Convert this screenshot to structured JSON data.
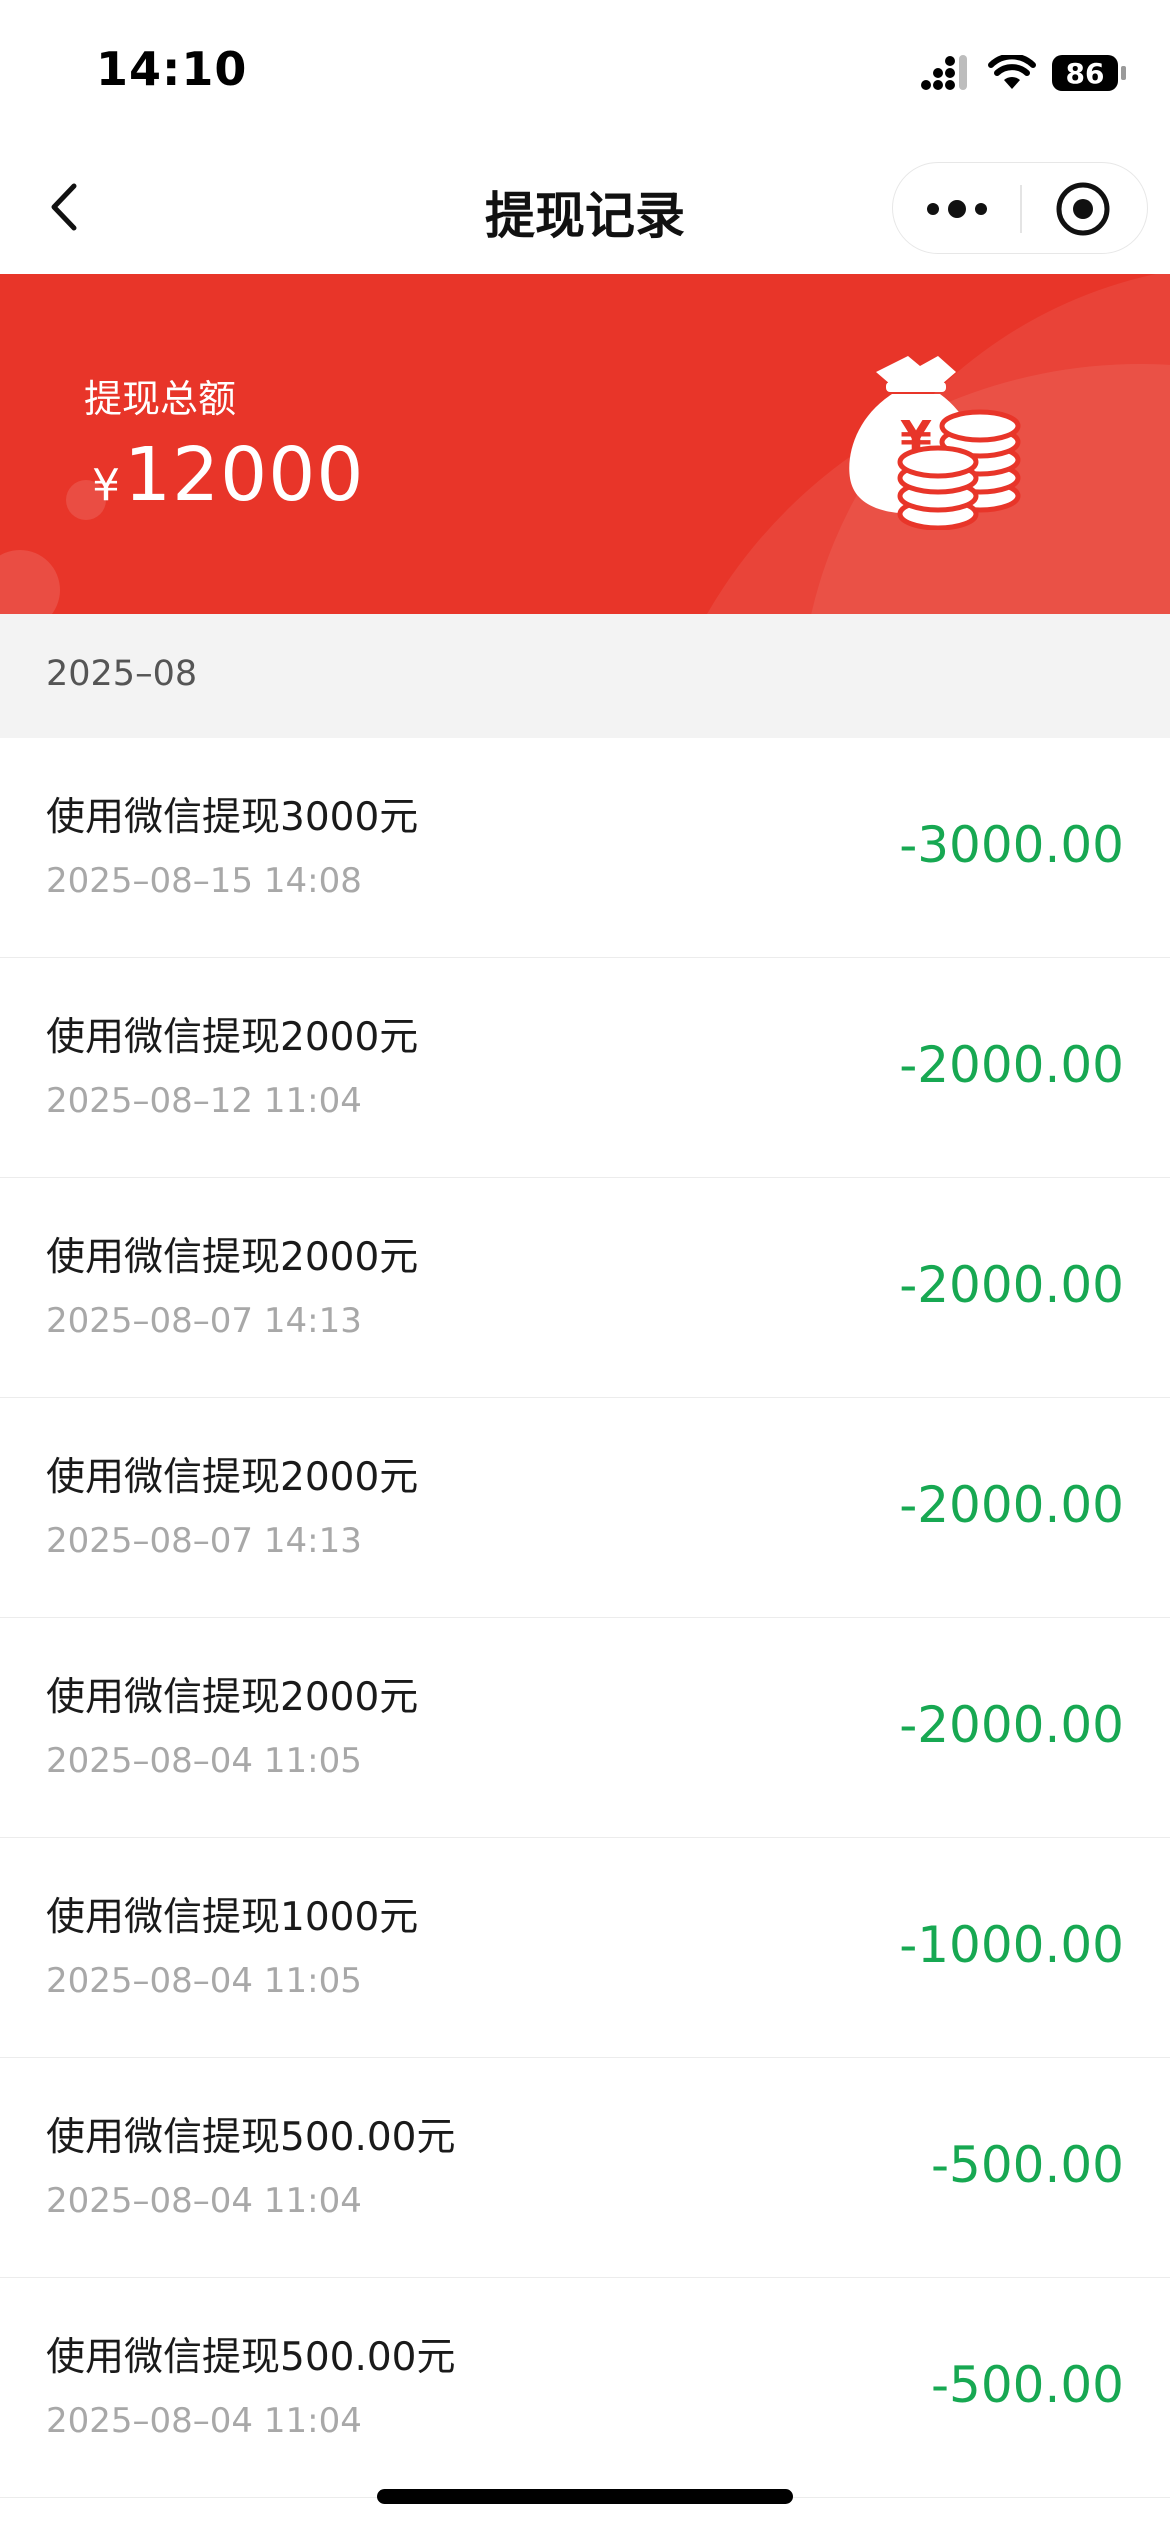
{
  "status_bar": {
    "time": "14:10",
    "battery": "86"
  },
  "nav": {
    "title": "提现记录"
  },
  "banner": {
    "label": "提现总额",
    "currency": "¥",
    "amount": "12000"
  },
  "colors": {
    "banner_red": "#e83529",
    "amount_green": "#17a852"
  },
  "month": "2025–08",
  "records": [
    {
      "title": "使用微信提现3000元",
      "time": "2025–08–15 14:08",
      "amount": "-3000.00"
    },
    {
      "title": "使用微信提现2000元",
      "time": "2025–08–12 11:04",
      "amount": "-2000.00"
    },
    {
      "title": "使用微信提现2000元",
      "time": "2025–08–07 14:13",
      "amount": "-2000.00"
    },
    {
      "title": "使用微信提现2000元",
      "time": "2025–08–07 14:13",
      "amount": "-2000.00"
    },
    {
      "title": "使用微信提现2000元",
      "time": "2025–08–04 11:05",
      "amount": "-2000.00"
    },
    {
      "title": "使用微信提现1000元",
      "time": "2025–08–04 11:05",
      "amount": "-1000.00"
    },
    {
      "title": "使用微信提现500.00元",
      "time": "2025–08–04 11:04",
      "amount": "-500.00"
    },
    {
      "title": "使用微信提现500.00元",
      "time": "2025–08–04 11:04",
      "amount": "-500.00"
    }
  ],
  "icons": {
    "back": "chevron-left-icon",
    "more": "more-dots-icon",
    "close": "miniprogram-close-icon",
    "money": "money-bag-coins-icon",
    "signal": "signal-icon",
    "wifi": "wifi-icon",
    "battery": "battery-icon"
  }
}
